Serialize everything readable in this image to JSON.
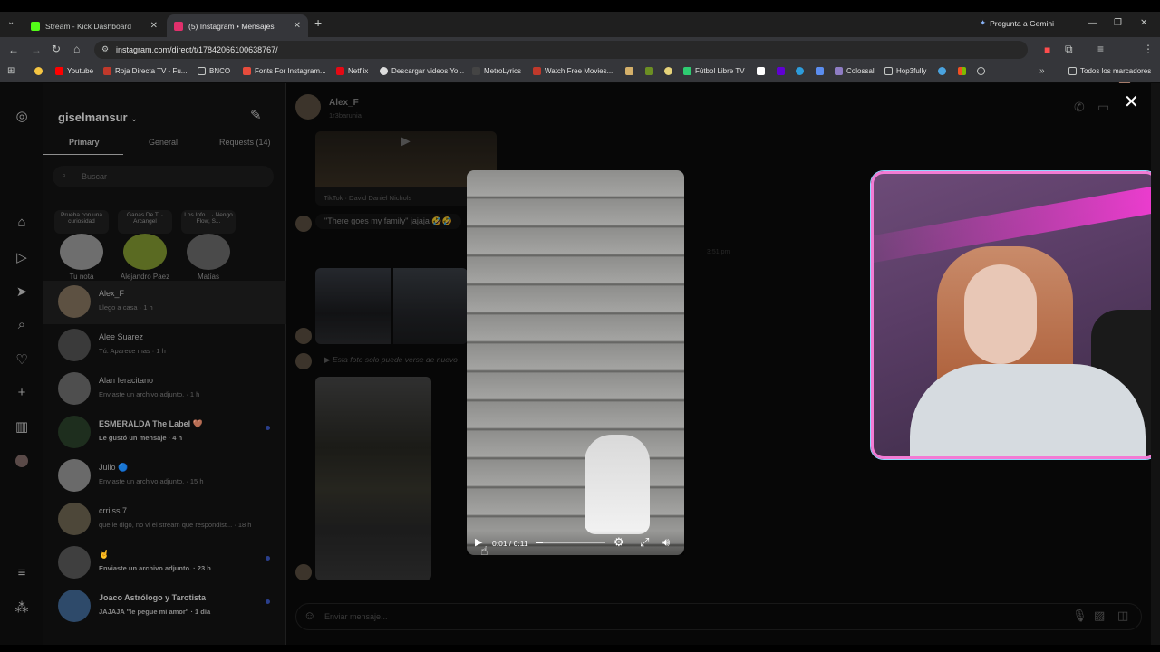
{
  "browser": {
    "tabs": [
      {
        "title": "Stream - Kick Dashboard",
        "favicon_color": "#53fc18"
      },
      {
        "title": "(5) Instagram • Mensajes",
        "favicon_color": "#e1306c"
      }
    ],
    "gemini_label": "Pregunta a Gemini",
    "url": "instagram.com/direct/t/17842066100638767/",
    "bookmarks": [
      "Youtube",
      "Roja Directa TV - Fu...",
      "BNCO",
      "Fonts For Instagram...",
      "Netflix",
      "Descargar videos Yo...",
      "MetroLyrics",
      "Watch Free Movies...",
      "Fútbol Libre TV",
      "Colossal",
      "Hop3fully"
    ],
    "all_bookmarks": "Todos los marcadores"
  },
  "inbox": {
    "username": "giselmansur",
    "tabs": [
      "Primary",
      "General",
      "Requests (14)"
    ],
    "search_placeholder": "Buscar",
    "notes": [
      {
        "bubble": "Prueba con una curiosidad",
        "name": "Tu nota"
      },
      {
        "bubble": "Ganas De Ti · Arcangel",
        "name": "Alejandro Paez"
      },
      {
        "bubble": "Los Info... · Nengo Flow, S...",
        "name": "Matías"
      }
    ],
    "conversations": [
      {
        "name": "Alex_F",
        "sub": "Llego a casa · 1 h",
        "bold": false
      },
      {
        "name": "Alee Suarez",
        "sub": "Tú: Aparece mas · 1 h",
        "bold": false
      },
      {
        "name": "Alan Ieracitano",
        "sub": "Enviaste un archivo adjunto. · 1 h",
        "bold": false
      },
      {
        "name": "ESMERALDA The Label 🤎",
        "sub": "Le gustó un mensaje · 4 h",
        "bold": true
      },
      {
        "name": "Julio 🔵",
        "sub": "Enviaste un archivo adjunto. · 15 h",
        "bold": false
      },
      {
        "name": "crriiss.7",
        "sub": "que le digo, no vi el stream que respondist... · 18 h",
        "bold": false
      },
      {
        "name": "🤘",
        "sub": "Enviaste un archivo adjunto. · 23 h",
        "bold": true
      },
      {
        "name": "Joaco Astrólogo y Tarotista",
        "sub": "JAJAJA \"le pegue mi amor\" · 1 día",
        "bold": true
      }
    ]
  },
  "chat": {
    "name": "Alex_F",
    "handle": "1r3barunia",
    "shared_label": "TikTok · David Daniel Nichols",
    "message": "\"There goes my family\" jajaja 🤣🤣",
    "timestamp": "3:51 pm",
    "view_once": "Esta foto solo puede verse de nuevo",
    "composer_placeholder": "Enviar mensaje..."
  },
  "video": {
    "time": "0:01 / 0:11",
    "progress": 0.09
  }
}
